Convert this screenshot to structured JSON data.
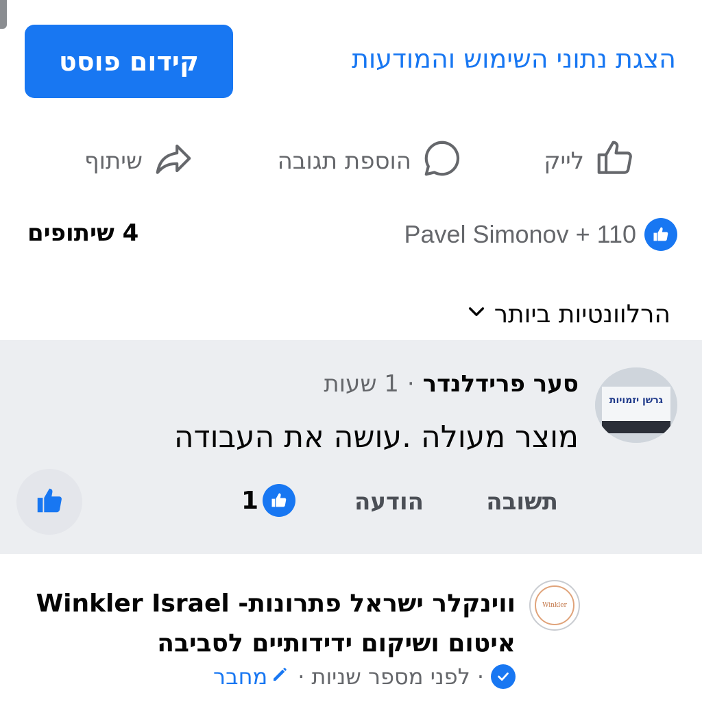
{
  "header": {
    "promote_label": "קידום פוסט",
    "insights_label": "הצגת נתוני השימוש והמודעות"
  },
  "actions": {
    "like_label": "לייק",
    "comment_label": "הוספת תגובה",
    "share_label": "שיתוף"
  },
  "stats": {
    "reactions_text": "Pavel Simonov + 110",
    "shares_text": "4 שיתופים"
  },
  "sort": {
    "label": "הרלוונטיות ביותר"
  },
  "comment": {
    "author": "סער פרידלנדר",
    "separator": "·",
    "time": "1 שעות",
    "text": "מוצר מעולה .עושה את העבודה",
    "reply_label": "תשובה",
    "message_label": "הודעה",
    "like_count": "1",
    "avatar_text": "גרשן יזמויות"
  },
  "reply": {
    "page_name": "ווינקלר ישראל פתרונות- Winkler Israel איטום ושיקום ידידותיים לסביבה",
    "avatar_text": "Winkler",
    "separator": "·",
    "time": "לפני מספר שניות",
    "author_badge": "מחבר"
  },
  "colors": {
    "accent": "#1877f2",
    "muted_text": "#65676b",
    "comment_bg": "#eceef1"
  }
}
